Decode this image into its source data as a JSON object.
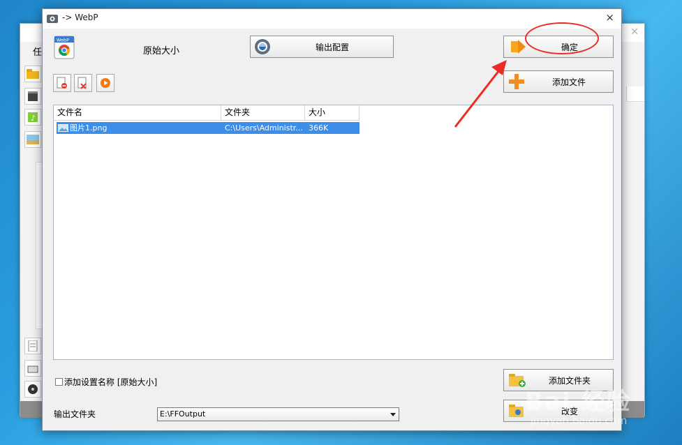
{
  "background_window": {
    "menu_fragment": "任"
  },
  "dialog": {
    "title": "-> WebP",
    "close_glyph": "×",
    "preset_label": "原始大小",
    "buttons": {
      "output_config": "输出配置",
      "ok": "确定",
      "add_file": "添加文件",
      "add_folder": "添加文件夹",
      "change": "改变"
    },
    "toolbar_icons": [
      "remove-icon",
      "clear-list-icon",
      "play-icon"
    ],
    "file_list": {
      "columns": [
        "文件名",
        "文件夹",
        "大小"
      ],
      "rows": [
        {
          "name": "图片1.png",
          "folder": "C:\\Users\\Administr...",
          "size": "366K",
          "selected": true
        }
      ]
    },
    "add_setting_name_checkbox": {
      "label": "添加设置名称 [原始大小]",
      "checked": false
    },
    "output_folder": {
      "label": "输出文件夹",
      "value": "E:\\FFOutput"
    }
  },
  "annotation": {
    "color": "#ee2a24"
  },
  "watermark": {
    "main": "Bai 经验",
    "url": "jingyan.baidu.com"
  },
  "colors": {
    "selection": "#3d8ee8",
    "desktop": "#2a9ee0"
  }
}
